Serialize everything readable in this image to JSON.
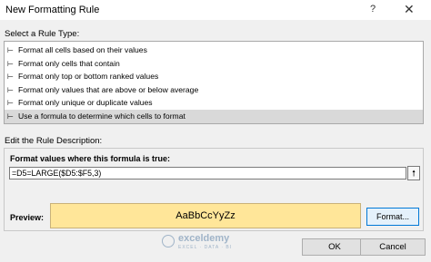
{
  "window": {
    "title": "New Formatting Rule",
    "help_glyph": "?",
    "close_glyph": "✕"
  },
  "rule_type": {
    "label": "Select a Rule Type:",
    "arrow_glyph": "⊢",
    "items": [
      {
        "label": "Format all cells based on their values"
      },
      {
        "label": "Format only cells that contain"
      },
      {
        "label": "Format only top or bottom ranked values"
      },
      {
        "label": "Format only values that are above or below average"
      },
      {
        "label": "Format only unique or duplicate values"
      },
      {
        "label": "Use a formula to determine which cells to format"
      }
    ],
    "selected_index": 5
  },
  "description": {
    "label": "Edit the Rule Description:",
    "formula_label": "Format values where this formula is true:",
    "formula_value": "=D5=LARGE($D5:$F5,3)",
    "collapse_glyph": "🠕",
    "preview_label": "Preview:",
    "preview_text": "AaBbCcYyZz",
    "preview_fill": "#ffe699",
    "format_button": "Format..."
  },
  "watermark": {
    "name": "exceldemy",
    "tagline": "EXCEL · DATA · BI"
  },
  "buttons": {
    "ok": "OK",
    "cancel": "Cancel"
  }
}
